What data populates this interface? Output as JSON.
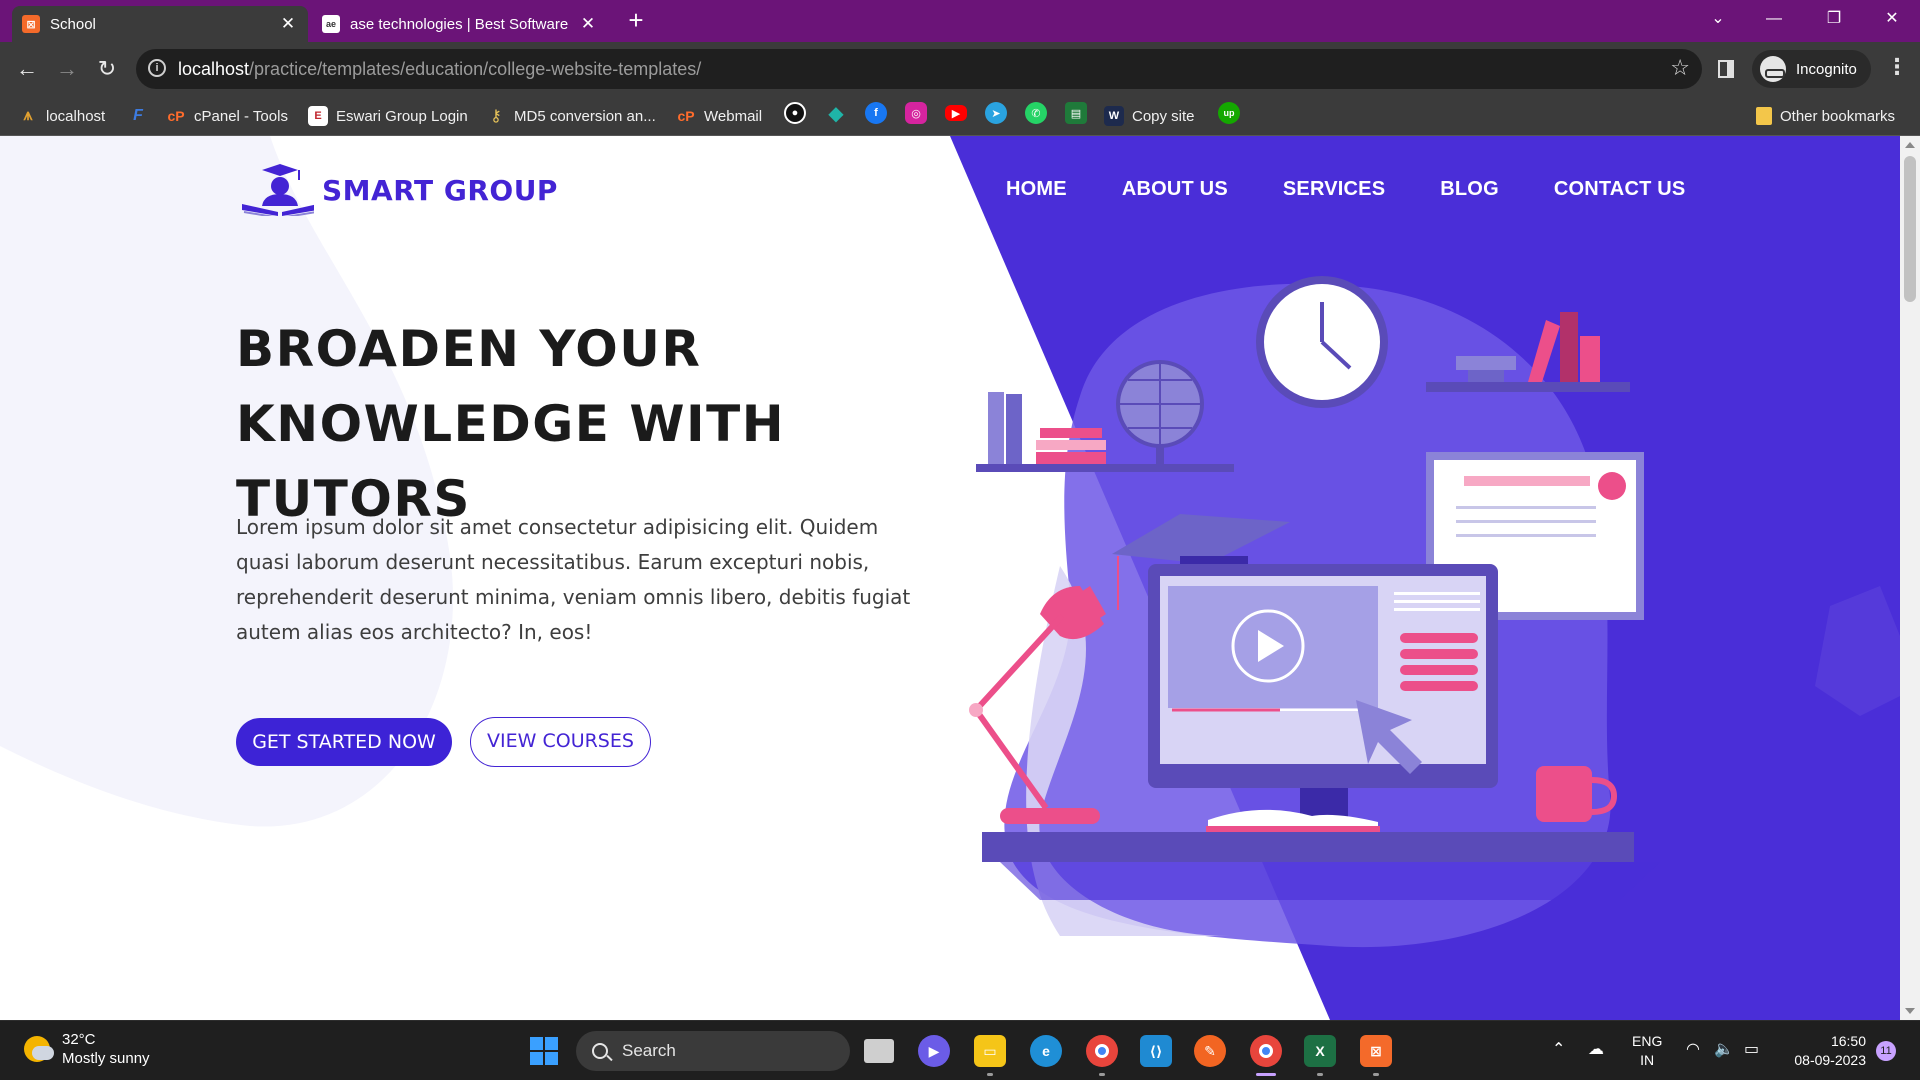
{
  "browser": {
    "tabs": [
      {
        "title": "School",
        "active": true
      },
      {
        "title": "ase technologies | Best Software",
        "active": false
      }
    ],
    "url_host": "localhost",
    "url_path": "/practice/templates/education/college-website-templates/",
    "incognito_label": "Incognito",
    "bookmarks": [
      {
        "label": "localhost"
      },
      {
        "label": "cPanel - Tools"
      },
      {
        "label": "Eswari Group Login"
      },
      {
        "label": "MD5 conversion an..."
      },
      {
        "label": "Webmail"
      },
      {
        "label": "Copy site"
      }
    ],
    "other_bookmarks": "Other bookmarks"
  },
  "page": {
    "brand": "SMART GROUP",
    "nav": [
      "HOME",
      "ABOUT US",
      "SERVICES",
      "BLOG",
      "CONTACT US"
    ],
    "hero_line1": "BROADEN YOUR",
    "hero_line2": "KNOWLEDGE WITH TUTORS",
    "hero_desc": "Lorem ipsum dolor sit amet consectetur adipisicing elit. Quidem quasi laborum deserunt necessitatibus. Earum excepturi nobis, reprehenderit deserunt minima, veniam omnis libero, debitis fugiat autem alias eos architecto? In, eos!",
    "cta_primary": "GET STARTED NOW",
    "cta_secondary": "VIEW COURSES",
    "colors": {
      "accent": "#4324d4",
      "pink": "#ec4f8a",
      "panel": "#4a2ed8"
    }
  },
  "taskbar": {
    "temp": "32°C",
    "weather": "Mostly sunny",
    "search_label": "Search",
    "lang1": "ENG",
    "lang2": "IN",
    "time": "16:50",
    "date": "08-09-2023",
    "notif_count": "11"
  }
}
